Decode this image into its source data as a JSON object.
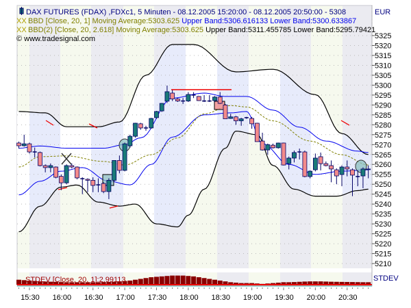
{
  "legend": {
    "title": "DAX FUTURES (FDAX) ,FDXc1, 5 Minuten - 08.12.2005 15:20:00 - 08.12.2005 20:50:00 - 5308",
    "bbd1_prefix": "XX",
    "bbd1_label": "BBD [Close, 20, 1] Moving Average:5303.625",
    "bbd1_bands": "Upper Band:5306.616133 Lower Band:5300.633867",
    "bbd2_prefix": "XX",
    "bbd2_label": "BBD(2) [Close, 20, 2.618] Moving Average:5303.625",
    "bbd2_bands": "Upper Band:5311.455785 Lower Band:5295.79421",
    "copyright": "© www.tradesignal.com",
    "currency": "EUR",
    "stdev_label": "STDEV [Close, 20, 1]:2.99113",
    "stdev_axis": "STDEV"
  },
  "colors": {
    "up": "#1a7a78",
    "down": "#f38a8a",
    "outline": "#000066",
    "outer_band": "#000000",
    "inner_band": "#0000ee",
    "ma": "#808000",
    "stdev": "#8b0000",
    "stripe_a": "#f6f9ee",
    "stripe_b": "#ebebf1",
    "band_a": "#ffffff",
    "band_b": "#e7ebfb"
  },
  "chart_data": {
    "type": "candlestick",
    "title": "DAX FUTURES (FDAX) ,FDXc1, 5 Minuten",
    "ylim": [
      5205,
      5330
    ],
    "y_ticks": [
      5325,
      5320,
      5315,
      5310,
      5305,
      5300,
      5295,
      5290,
      5285,
      5280,
      5275,
      5270,
      5265,
      5260,
      5255,
      5250,
      5245,
      5240,
      5235,
      5230,
      5225,
      5220,
      5215,
      5210
    ],
    "x_ticks": [
      "15:30",
      "16:00",
      "16:30",
      "17:00",
      "17:30",
      "18:00",
      "18:30",
      "19:00",
      "19:30",
      "20:00",
      "20:30"
    ],
    "x_tick_bar_index": [
      2,
      8,
      14,
      20,
      26,
      32,
      38,
      44,
      50,
      56,
      62
    ],
    "ohlc": [
      [
        5270.8,
        5271.5,
        5268.0,
        5269.4
      ],
      [
        5269.4,
        5275.0,
        5269.0,
        5270.4
      ],
      [
        5270.4,
        5271.0,
        5265.5,
        5266.3
      ],
      [
        5266.3,
        5268.5,
        5263.5,
        5266.3
      ],
      [
        5266.0,
        5266.5,
        5259.0,
        5259.4
      ],
      [
        5259.4,
        5260.0,
        5256.0,
        5258.4
      ],
      [
        5258.4,
        5260.5,
        5256.0,
        5259.4
      ],
      [
        5258.7,
        5259.0,
        5253.0,
        5253.5
      ],
      [
        5254.0,
        5255.0,
        5247.0,
        5250.7
      ],
      [
        5250.7,
        5260.0,
        5250.0,
        5259.4
      ],
      [
        5259.4,
        5260.5,
        5258.0,
        5258.7
      ],
      [
        5258.7,
        5259.0,
        5252.5,
        5253.2
      ],
      [
        5252.8,
        5253.5,
        5245.0,
        5252.8
      ],
      [
        5252.5,
        5253.0,
        5246.0,
        5252.0
      ],
      [
        5252.0,
        5253.5,
        5246.0,
        5249.4
      ],
      [
        5249.7,
        5253.0,
        5246.0,
        5249.7
      ],
      [
        5250.4,
        5251.0,
        5245.5,
        5246.3
      ],
      [
        5246.3,
        5253.0,
        5242.5,
        5252.0
      ],
      [
        5252.0,
        5262.0,
        5251.5,
        5262.0
      ],
      [
        5262.0,
        5264.5,
        5255.5,
        5257.0
      ],
      [
        5257.0,
        5271.0,
        5256.5,
        5270.4
      ],
      [
        5269.4,
        5275.0,
        5268.5,
        5274.2
      ],
      [
        5274.2,
        5281.0,
        5273.5,
        5280.8
      ],
      [
        5280.5,
        5281.0,
        5277.5,
        5278.4
      ],
      [
        5278.4,
        5279.5,
        5277.0,
        5278.4
      ],
      [
        5278.4,
        5283.5,
        5278.0,
        5283.2
      ],
      [
        5283.6,
        5287.0,
        5283.0,
        5286.7
      ],
      [
        5287.0,
        5291.0,
        5286.5,
        5290.8
      ],
      [
        5291.9,
        5299.8,
        5291.0,
        5296.7
      ],
      [
        5296.0,
        5297.5,
        5292.0,
        5293.0
      ],
      [
        5293.0,
        5293.5,
        5291.5,
        5292.0
      ],
      [
        5292.0,
        5293.5,
        5290.5,
        5292.0
      ],
      [
        5292.0,
        5296.5,
        5291.5,
        5295.3
      ],
      [
        5295.0,
        5296.5,
        5293.5,
        5295.0
      ],
      [
        5294.3,
        5294.5,
        5292.0,
        5292.2
      ],
      [
        5292.0,
        5295.0,
        5291.5,
        5292.0
      ],
      [
        5292.0,
        5295.0,
        5291.5,
        5292.0
      ],
      [
        5292.2,
        5294.5,
        5291.5,
        5294.0
      ],
      [
        5294.0,
        5296.5,
        5290.5,
        5290.8
      ],
      [
        5290.0,
        5290.5,
        5283.0,
        5283.0
      ],
      [
        5283.2,
        5285.5,
        5283.0,
        5284.0
      ],
      [
        5284.0,
        5284.5,
        5280.0,
        5282.0
      ],
      [
        5282.0,
        5283.5,
        5279.5,
        5283.0
      ],
      [
        5283.6,
        5284.0,
        5283.0,
        5283.6
      ],
      [
        5283.2,
        5284.0,
        5278.0,
        5280.5
      ],
      [
        5280.8,
        5281.0,
        5271.5,
        5271.5
      ],
      [
        5271.8,
        5276.0,
        5267.0,
        5267.3
      ],
      [
        5267.3,
        5270.5,
        5265.0,
        5270.0
      ],
      [
        5269.7,
        5270.5,
        5268.0,
        5268.4
      ],
      [
        5268.4,
        5271.0,
        5268.0,
        5270.8
      ],
      [
        5270.8,
        5271.0,
        5259.5,
        5259.7
      ],
      [
        5260.4,
        5264.0,
        5257.5,
        5263.2
      ],
      [
        5263.2,
        5267.0,
        5261.0,
        5266.0
      ],
      [
        5266.3,
        5268.0,
        5262.5,
        5266.3
      ],
      [
        5266.3,
        5267.0,
        5253.5,
        5253.9
      ],
      [
        5253.9,
        5257.0,
        5253.0,
        5256.6
      ],
      [
        5257.3,
        5265.5,
        5256.5,
        5263.2
      ],
      [
        5263.9,
        5266.0,
        5257.0,
        5260.4
      ],
      [
        5260.4,
        5261.5,
        5259.0,
        5259.4
      ],
      [
        5259.4,
        5262.0,
        5251.0,
        5257.7
      ],
      [
        5257.3,
        5258.0,
        5250.0,
        5254.2
      ],
      [
        5254.9,
        5259.5,
        5249.0,
        5258.7
      ],
      [
        5258.7,
        5262.0,
        5254.0,
        5257.7
      ],
      [
        5257.3,
        5258.0,
        5244.0,
        5254.6
      ],
      [
        5253.9,
        5257.0,
        5249.0,
        5253.9
      ],
      [
        5254.2,
        5258.5,
        5248.0,
        5257.7
      ],
      [
        5257.4,
        5259.5,
        5253.0,
        5257.7
      ]
    ],
    "series": [
      {
        "name": "BBD(2) Upper Band",
        "points": [
          [
            0,
            5286.7
          ],
          [
            5,
            5286
          ],
          [
            9,
            5279
          ],
          [
            15,
            5279
          ],
          [
            19,
            5281.4
          ],
          [
            24,
            5305
          ],
          [
            29,
            5320.5
          ],
          [
            33,
            5320.5
          ],
          [
            41,
            5306.7
          ],
          [
            48,
            5308
          ],
          [
            56,
            5295.2
          ],
          [
            61,
            5275.6
          ],
          [
            66,
            5265
          ]
        ]
      },
      {
        "name": "BBD(2) Lower Band",
        "points": [
          [
            0,
            5226
          ],
          [
            4,
            5238.9
          ],
          [
            8,
            5248.6
          ],
          [
            11,
            5249.6
          ],
          [
            15,
            5241
          ],
          [
            19,
            5239
          ],
          [
            22,
            5240
          ],
          [
            26,
            5230
          ],
          [
            30,
            5228.5
          ],
          [
            32,
            5234.4
          ],
          [
            35,
            5247.5
          ],
          [
            39,
            5268.2
          ],
          [
            41,
            5276.8
          ],
          [
            45,
            5275
          ],
          [
            48,
            5259.5
          ],
          [
            52,
            5247.5
          ],
          [
            56,
            5244
          ],
          [
            60,
            5244
          ],
          [
            64,
            5246.8
          ],
          [
            66,
            5247.5
          ]
        ]
      },
      {
        "name": "BBD Upper Band",
        "points": [
          [
            0,
            5268.2
          ],
          [
            4,
            5269.3
          ],
          [
            9,
            5268.2
          ],
          [
            16,
            5268.2
          ],
          [
            20,
            5270
          ],
          [
            23,
            5273.4
          ],
          [
            29,
            5293.5
          ],
          [
            35,
            5296
          ],
          [
            39,
            5294.3
          ],
          [
            43,
            5294.3
          ],
          [
            48,
            5287.4
          ],
          [
            53,
            5278.8
          ],
          [
            58,
            5271.8
          ],
          [
            64,
            5266.7
          ],
          [
            66,
            5266
          ]
        ]
      },
      {
        "name": "BBD Lower Band",
        "points": [
          [
            0,
            5244.6
          ],
          [
            4,
            5251.5
          ],
          [
            8,
            5256.6
          ],
          [
            12,
            5258.4
          ],
          [
            17,
            5251.5
          ],
          [
            21,
            5249.7
          ],
          [
            25,
            5260
          ],
          [
            29,
            5273.8
          ],
          [
            35,
            5285
          ],
          [
            40,
            5286
          ],
          [
            43,
            5286.7
          ],
          [
            46,
            5270.5
          ],
          [
            51,
            5260
          ],
          [
            56,
            5255
          ],
          [
            61,
            5256.6
          ],
          [
            66,
            5257.3
          ]
        ]
      },
      {
        "name": "Moving Average",
        "points": [
          [
            0,
            5258.7
          ],
          [
            4,
            5263.9
          ],
          [
            9,
            5264.3
          ],
          [
            16,
            5261.5
          ],
          [
            20,
            5259.7
          ],
          [
            25,
            5264.9
          ],
          [
            30,
            5273.4
          ],
          [
            35,
            5285.5
          ],
          [
            40,
            5289.7
          ],
          [
            43,
            5289
          ],
          [
            48,
            5282
          ],
          [
            55,
            5271.8
          ],
          [
            61,
            5264.9
          ],
          [
            66,
            5259.7
          ]
        ]
      }
    ],
    "stdev": [
      6,
      5.5,
      5,
      4.5,
      4,
      3.8,
      3.6,
      3.4,
      3.2,
      3,
      3,
      3,
      3,
      3,
      3,
      3,
      3.2,
      3.4,
      3.6,
      4,
      4.5,
      5,
      6,
      7,
      8,
      9,
      9.5,
      10,
      10.5,
      11,
      11,
      11,
      10.5,
      10,
      9,
      8,
      7,
      6,
      5,
      4,
      3,
      2.5,
      2,
      2,
      2,
      1.5,
      1,
      1.5,
      2,
      2.5,
      3,
      3,
      3.2,
      3.5,
      3.8,
      4,
      4,
      4,
      3.8,
      3.6,
      3.5,
      3.4,
      3.3,
      3.2,
      3.1,
      3,
      2.99
    ],
    "stdev_max": 11.5
  }
}
